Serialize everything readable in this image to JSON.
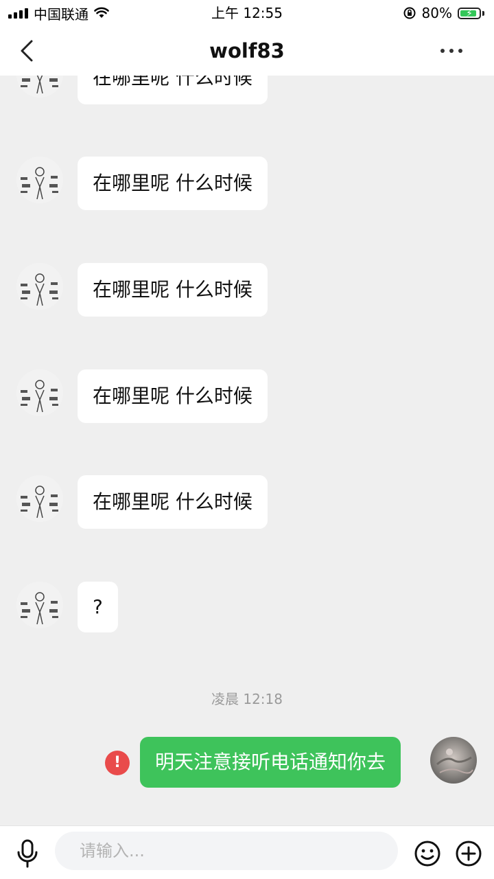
{
  "status_bar": {
    "carrier": "中国联通",
    "time": "上午 12:55",
    "battery_percent": "80%",
    "icons": [
      "signal-icon",
      "wifi-icon",
      "rotation-lock-icon",
      "battery-charging-icon"
    ]
  },
  "header": {
    "title": "wolf83",
    "icons": [
      "back-chevron-icon",
      "more-options-icon"
    ]
  },
  "messages": [
    {
      "sender": "contact",
      "text": "在哪里呢 什么时候"
    },
    {
      "sender": "contact",
      "text": "在哪里呢 什么时候"
    },
    {
      "sender": "contact",
      "text": "在哪里呢 什么时候"
    },
    {
      "sender": "contact",
      "text": "在哪里呢 什么时候"
    },
    {
      "sender": "contact",
      "text": "在哪里呢 什么时候"
    },
    {
      "sender": "contact",
      "text": "?"
    }
  ],
  "timestamp": "凌晨 12:18",
  "outgoing": {
    "text": "明天注意接听电话通知你去",
    "status": "failed",
    "status_icon": "!"
  },
  "input_bar": {
    "placeholder": "请输入...",
    "icons": [
      "microphone-icon",
      "emoji-icon",
      "add-icon"
    ]
  },
  "colors": {
    "background": "#efefef",
    "bubble_incoming": "#ffffff",
    "bubble_outgoing": "#3ec35b",
    "error": "#e94b4b",
    "timestamp": "#9a9a9a"
  }
}
